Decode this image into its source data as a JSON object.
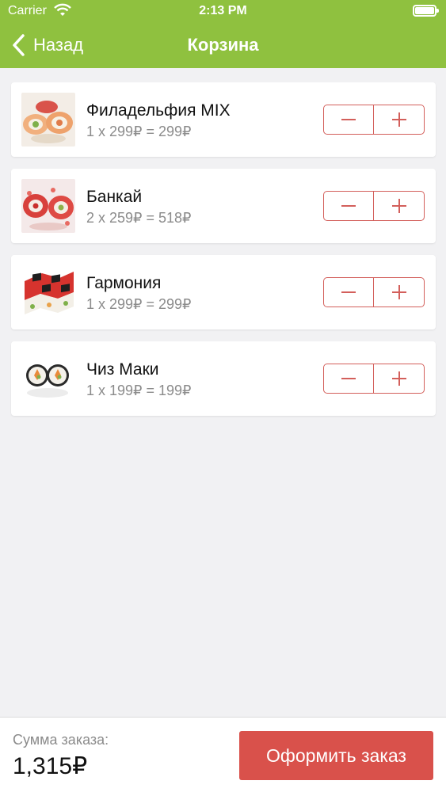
{
  "status_bar": {
    "carrier": "Carrier",
    "time": "2:13 PM"
  },
  "nav": {
    "back_label": "Назад",
    "title": "Корзина"
  },
  "colors": {
    "accent": "#8fc13f",
    "button": "#d9514b",
    "stepper": "#d35f5b"
  },
  "items": [
    {
      "name": "Филадельфия MIX",
      "price_line": "1 x 299₽ = 299₽",
      "image": "sushi-roll-philadelphia"
    },
    {
      "name": "Банкай",
      "price_line": "2 x 259₽ = 518₽",
      "image": "sushi-roll-bankai"
    },
    {
      "name": "Гармония",
      "price_line": "1 x 299₽ = 299₽",
      "image": "sushi-roll-garmonia"
    },
    {
      "name": "Чиз Маки",
      "price_line": "1 x 199₽ = 199₽",
      "image": "sushi-roll-cheese-maki"
    }
  ],
  "footer": {
    "sum_label": "Сумма заказа:",
    "sum_value": "1,315₽",
    "checkout_label": "Оформить заказ"
  }
}
